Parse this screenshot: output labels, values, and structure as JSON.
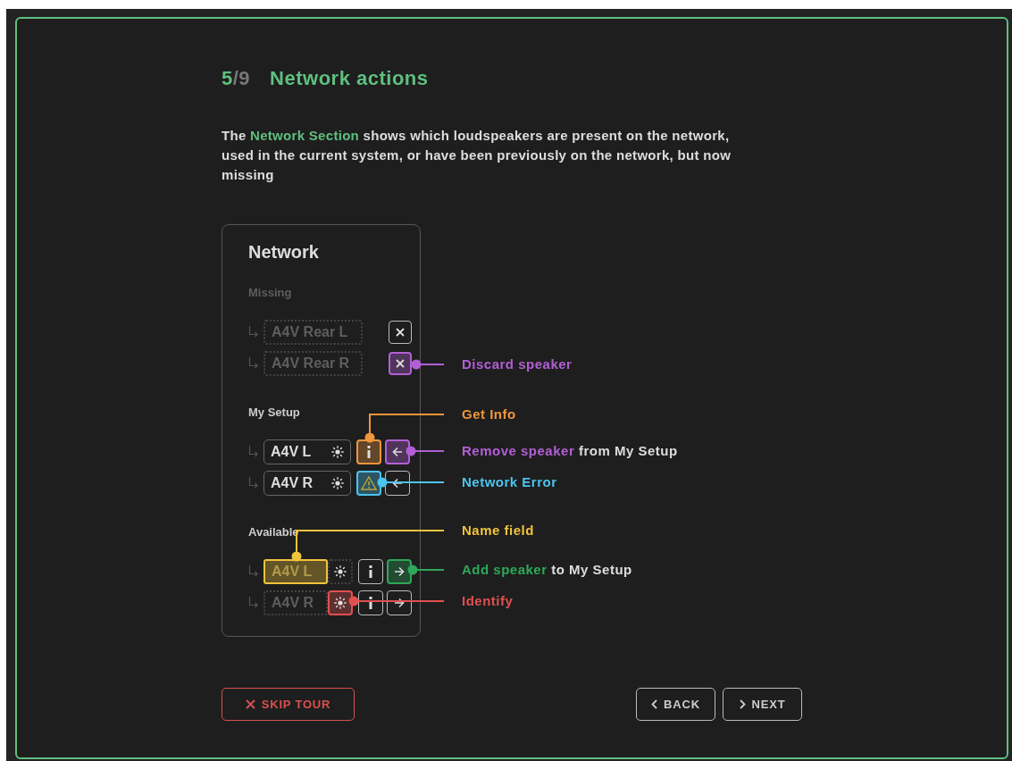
{
  "step": {
    "current": "5",
    "total": "/9"
  },
  "title": "Network actions",
  "description": [
    {
      "text": "The ",
      "highlight": false
    },
    {
      "text": "Network Section",
      "highlight": true
    },
    {
      "text": " shows which loudspeakers are present on the network, used in the current system, or have been previously on the network, but now missing",
      "highlight": false
    }
  ],
  "panel": {
    "title": "Network",
    "sections": [
      {
        "label": "Missing",
        "kind": "missing",
        "rows": [
          {
            "name": "A4V Rear L",
            "controls": [
              {
                "kind": "discard"
              }
            ]
          },
          {
            "name": "A4V Rear R",
            "controls": [
              {
                "kind": "discard",
                "color": "#b25fd6"
              }
            ]
          }
        ]
      },
      {
        "label": "My Setup",
        "kind": "setup",
        "rows": [
          {
            "name": "A4V L",
            "controls": [
              {
                "kind": "identify"
              },
              {
                "kind": "info",
                "color": "#f0963c"
              },
              {
                "kind": "remove",
                "color": "#b25fd6"
              }
            ]
          },
          {
            "name": "A4V R",
            "controls": [
              {
                "kind": "identify"
              },
              {
                "kind": "warning",
                "color": "#4cc4ee"
              },
              {
                "kind": "remove"
              }
            ]
          }
        ]
      },
      {
        "label": "Available",
        "kind": "available",
        "rows": [
          {
            "name": "A4V L",
            "color": "#f0c43c",
            "controls": [
              {
                "kind": "identify"
              },
              {
                "kind": "info"
              },
              {
                "kind": "add",
                "color": "#2ea85a"
              }
            ]
          },
          {
            "name": "A4V R",
            "controls": [
              {
                "kind": "identify",
                "color": "#e05050"
              },
              {
                "kind": "info"
              },
              {
                "kind": "add"
              }
            ]
          }
        ]
      }
    ]
  },
  "callouts": [
    {
      "color": "#b25fd6",
      "parts": [
        {
          "text": "Discard speaker",
          "accent": true
        }
      ]
    },
    {
      "color": "#f0963c",
      "parts": [
        {
          "text": "Get Info",
          "accent": true
        }
      ]
    },
    {
      "color": "#b25fd6",
      "parts": [
        {
          "text": "Remove speaker",
          "accent": true
        },
        {
          "text": " from My Setup",
          "accent": false
        }
      ]
    },
    {
      "color": "#4cc4ee",
      "parts": [
        {
          "text": "Network Error",
          "accent": true
        }
      ]
    },
    {
      "color": "#f0c43c",
      "parts": [
        {
          "text": "Name field",
          "accent": true
        }
      ]
    },
    {
      "color": "#2ea85a",
      "parts": [
        {
          "text": "Add speaker",
          "accent": true
        },
        {
          "text": " to My Setup",
          "accent": false
        }
      ]
    },
    {
      "color": "#e05050",
      "parts": [
        {
          "text": "Identify",
          "accent": true
        }
      ]
    }
  ],
  "buttons": [
    {
      "kind": "skip",
      "label": "SKIP TOUR"
    },
    {
      "kind": "back",
      "label": "BACK"
    },
    {
      "kind": "next",
      "label": "NEXT"
    }
  ]
}
